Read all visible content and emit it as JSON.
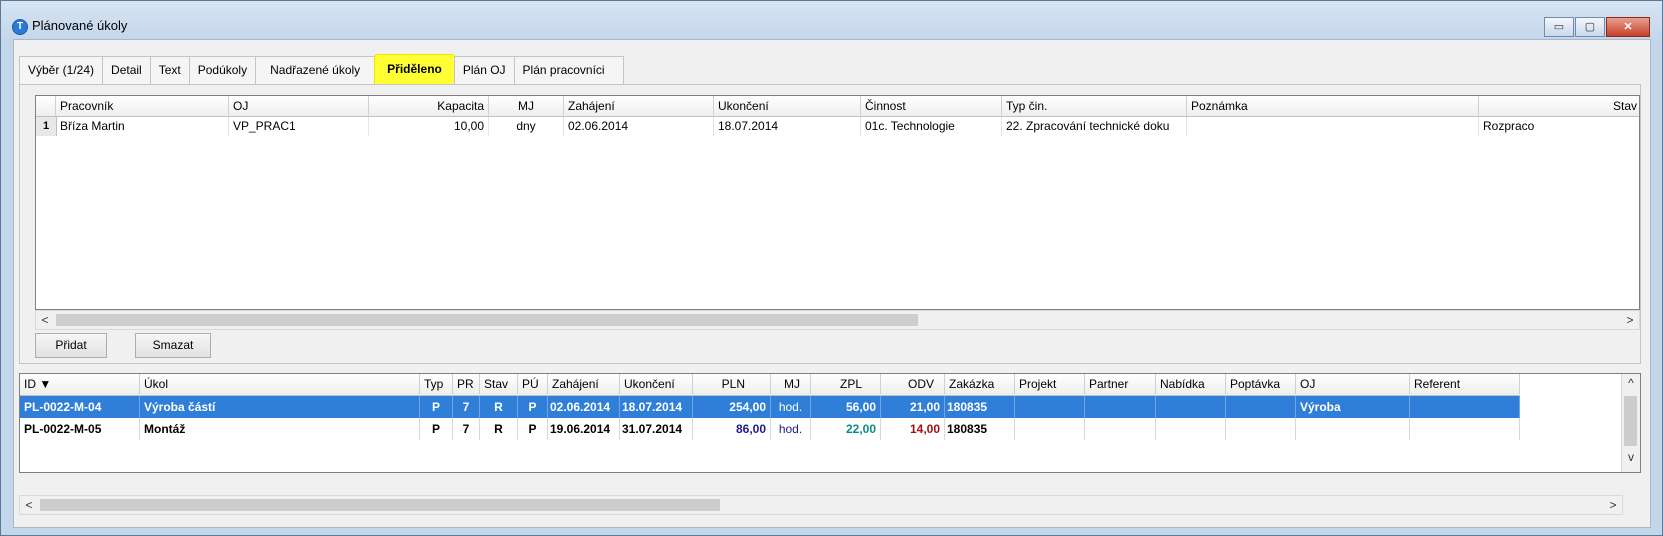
{
  "window": {
    "title": "Plánované úkoly",
    "icon": "app-logo-icon",
    "controls": {
      "minimize": "▭",
      "maximize": "▢",
      "close": "✕"
    }
  },
  "tabs": [
    {
      "label": "Výběr (1/24)"
    },
    {
      "label": "Detail"
    },
    {
      "label": "Text"
    },
    {
      "label": "Podúkoly"
    },
    {
      "label": "Nadřazené úkoly"
    },
    {
      "label": "Přiděleno",
      "active": true
    },
    {
      "label": "Plán OJ"
    },
    {
      "label": "Plán pracovníci"
    }
  ],
  "assigned_grid": {
    "columns": [
      "Pracovník",
      "OJ",
      "Kapacita",
      "MJ",
      "Zahájení",
      "Ukončení",
      "Činnost",
      "Typ čin.",
      "Poznámka",
      "Stav"
    ],
    "rows": [
      {
        "num": "1",
        "pracovnik": "Bříza Martin",
        "oj": "VP_PRAC1",
        "kapacita": "10,00",
        "mj": "dny",
        "zahajeni": "02.06.2014",
        "ukonceni": "18.07.2014",
        "cinnost": "01c. Technologie",
        "typ_cin": "22. Zpracování technické doku",
        "poznamka": "",
        "stav": "Rozpraco"
      }
    ],
    "scroll_left": "<",
    "scroll_right": ">"
  },
  "buttons": {
    "add": "Přidat",
    "delete": "Smazat"
  },
  "tasks_grid": {
    "columns": [
      "ID ▼",
      "Úkol",
      "Typ",
      "PR",
      "Stav",
      "PÚ",
      "Zahájení",
      "Ukončení",
      "PLN",
      "MJ",
      "ZPL",
      "ODV",
      "Zakázka",
      "Projekt",
      "Partner",
      "Nabídka",
      "Poptávka",
      "OJ",
      "Referent"
    ],
    "rows": [
      {
        "id": "PL-0022-M-04",
        "ukol": "Výroba částí",
        "typ": "P",
        "pr": "7",
        "stav": "R",
        "pu": "P",
        "zahajeni": "02.06.2014",
        "ukonceni": "18.07.2014",
        "pln": "254,00",
        "mj": "hod.",
        "zpl": "56,00",
        "odv": "21,00",
        "zakazka": "180835",
        "projekt": "",
        "partner": "",
        "nabidka": "",
        "poptavka": "",
        "oj": "Výroba",
        "referent": "",
        "selected": true
      },
      {
        "id": "PL-0022-M-05",
        "ukol": "Montáž",
        "typ": "P",
        "pr": "7",
        "stav": "R",
        "pu": "P",
        "zahajeni": "19.06.2014",
        "ukonceni": "31.07.2014",
        "pln": "86,00",
        "mj": "hod.",
        "zpl": "22,00",
        "odv": "14,00",
        "zakazka": "180835",
        "projekt": "",
        "partner": "",
        "nabidka": "",
        "poptavka": "",
        "oj": "",
        "referent": "",
        "selected": false
      }
    ],
    "colors": {
      "pln": "#1a1a8c",
      "mj": "#1a1a8c",
      "zpl": "#0a8a8a",
      "odv": "#a01010",
      "selection": "#2f7ed8"
    },
    "scroll_up": "^",
    "scroll_down": "v",
    "scroll_left": "<",
    "scroll_right": ">"
  }
}
